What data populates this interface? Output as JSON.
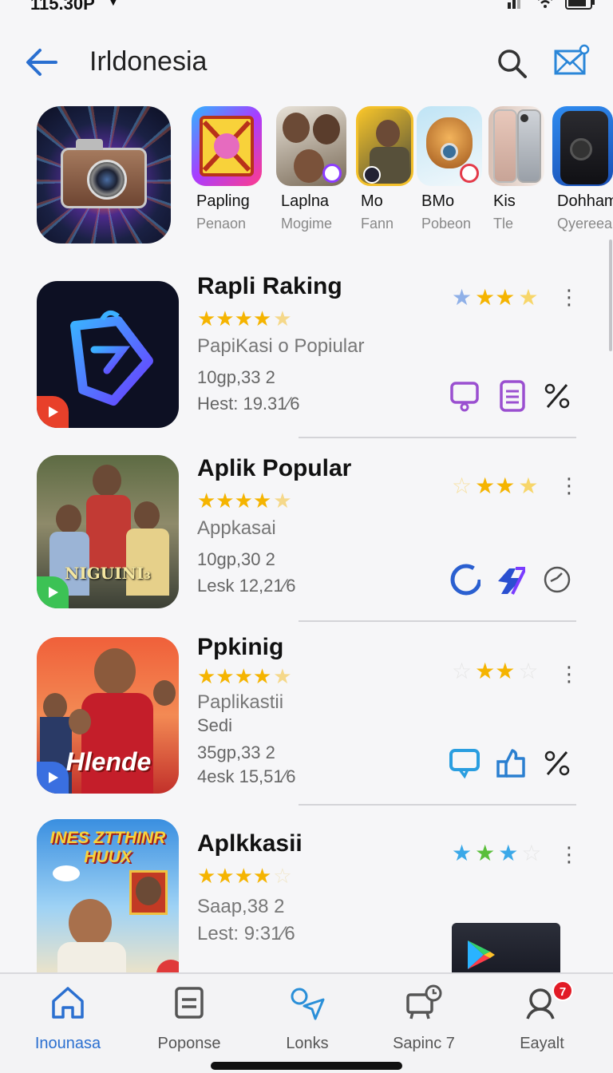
{
  "status_bar": {
    "time": "115.30P"
  },
  "header": {
    "title": "Irldonesia"
  },
  "featured": {
    "apps": [
      {
        "name": "Papling",
        "sub": "Penaon"
      },
      {
        "name": "Laplna",
        "sub": "Mogime"
      },
      {
        "name": "Mo",
        "sub": "Fann"
      },
      {
        "name": "BMo",
        "sub": "Pobeon"
      },
      {
        "name": "Kis",
        "sub": "Tle"
      },
      {
        "name": "Dohham",
        "sub": "Qyereea"
      }
    ]
  },
  "list": [
    {
      "title": "Rapli Raking",
      "line1": "PapiKasi o Popiular",
      "line2": "10gp,33 2",
      "line3": "Hest: 19.31⁄6",
      "stars": 4.5,
      "right_rating": 3.5
    },
    {
      "title": "Aplik Popular",
      "line1": "Appkasai",
      "line2": "10gp,30 2",
      "line3": "Lesk 12,21⁄6",
      "stars": 4.5,
      "right_rating": 2.5,
      "icon_text": "NIGUINI₃"
    },
    {
      "title": "Ppkinig",
      "line1": "Paplikastii",
      "line2": "Sedi",
      "line3": "35gp,33 2",
      "line4": "4esk 15,51⁄6",
      "stars": 4.5,
      "right_rating": 2,
      "icon_text": "Hlende"
    },
    {
      "title": "Aplkkasii",
      "line1": "Saap,38 2",
      "line2": "Lest: 9:31⁄6",
      "stars": 4,
      "right_rating": 2.5,
      "icon_text": "INES ZTTHINR HUUX"
    }
  ],
  "bottom_nav": {
    "items": [
      {
        "label": "Inounasa"
      },
      {
        "label": "Poponse"
      },
      {
        "label": "Lonks"
      },
      {
        "label": "Sapinc 7"
      },
      {
        "label": "Eayalt",
        "badge": "7"
      }
    ]
  },
  "colors": {
    "accent": "#2a6fd0",
    "star": "#f5b400"
  }
}
